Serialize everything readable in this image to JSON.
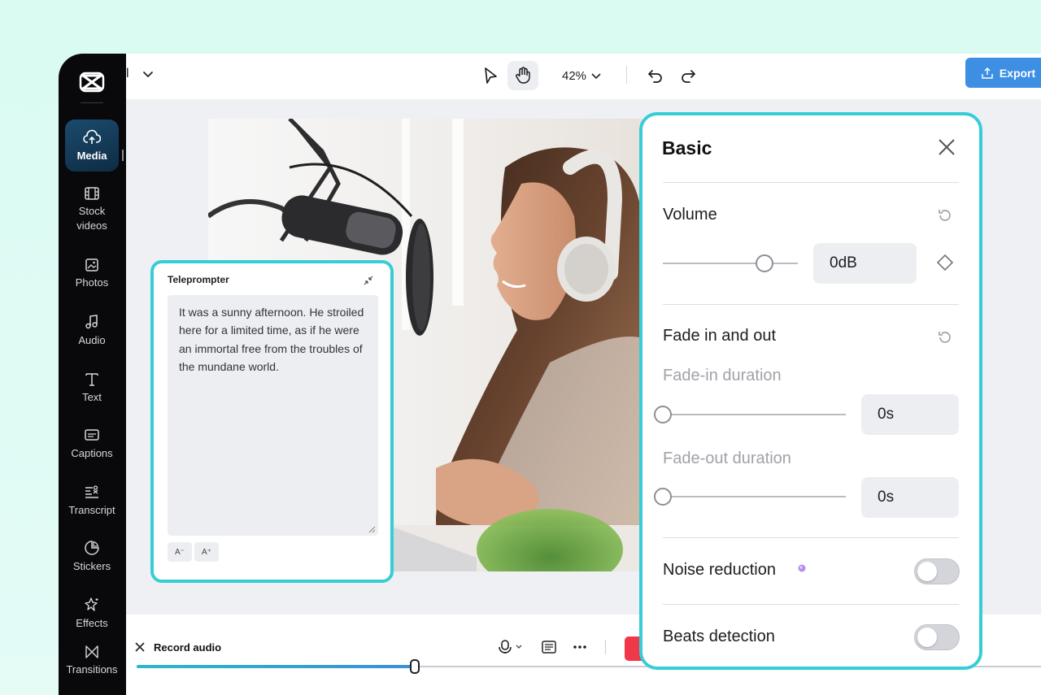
{
  "sidebar": {
    "items": [
      {
        "label": "Media",
        "icon": "cloud-upload-icon"
      },
      {
        "label": "Stock videos",
        "icon": "film-icon"
      },
      {
        "label": "Photos",
        "icon": "image-icon"
      },
      {
        "label": "Audio",
        "icon": "music-note-icon"
      },
      {
        "label": "Text",
        "icon": "text-t-icon"
      },
      {
        "label": "Captions",
        "icon": "captions-icon"
      },
      {
        "label": "Transcript",
        "icon": "transcript-icon"
      },
      {
        "label": "Stickers",
        "icon": "sticker-icon"
      },
      {
        "label": "Effects",
        "icon": "sparkle-icon"
      },
      {
        "label": "Transitions",
        "icon": "transition-icon"
      }
    ],
    "active": "Media"
  },
  "topbar": {
    "project_name": "l",
    "zoom": "42%",
    "export_label": "Export"
  },
  "teleprompter": {
    "title": "Teleprompter",
    "text": "It was a sunny afternoon. He stroiled here for a limited time, as if he were an immortal free from the troubles of the mundane world.",
    "decrease_font": "A⁻",
    "increase_font": "A⁺"
  },
  "panel": {
    "title": "Basic",
    "volume": {
      "label": "Volume",
      "value": "0dB",
      "level": 0.75
    },
    "fade": {
      "label": "Fade in and out",
      "fade_in_label": "Fade-in duration",
      "fade_in_value": "0s",
      "fade_out_label": "Fade-out duration",
      "fade_out_value": "0s"
    },
    "noise_reduction": {
      "label": "Noise reduction",
      "enabled": false
    },
    "beats_detection": {
      "label": "Beats detection",
      "enabled": false
    }
  },
  "record": {
    "title": "Record audio",
    "progress": 0.3
  },
  "colors": {
    "accent": "#37cdd7",
    "export": "#3d8fe4",
    "sidebar_bg": "#09090b"
  }
}
